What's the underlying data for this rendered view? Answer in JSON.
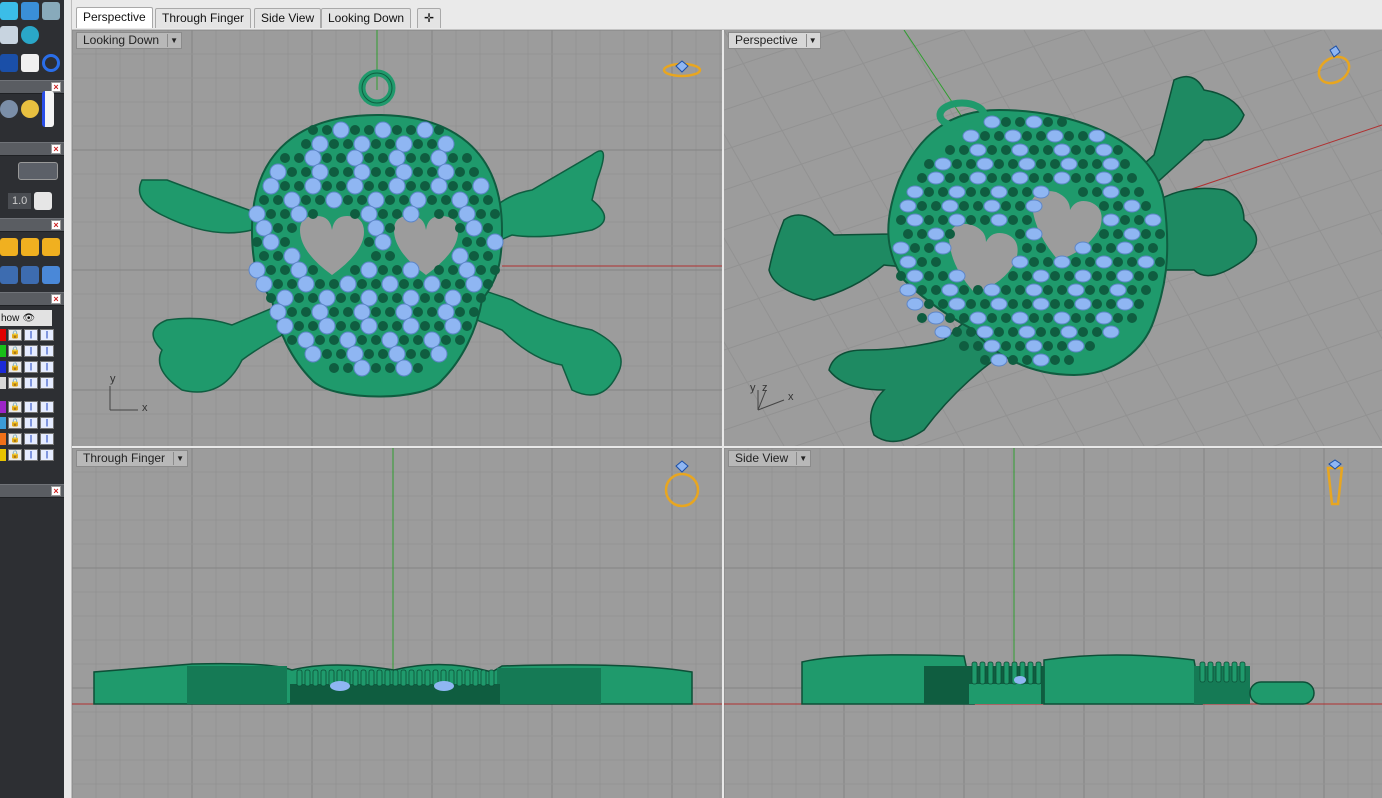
{
  "tabs": [
    {
      "label": "Perspective",
      "active": true
    },
    {
      "label": "Through Finger",
      "active": false
    },
    {
      "label": "Side View",
      "active": false
    },
    {
      "label": "Looking Down",
      "active": false
    }
  ],
  "tab_add_icon": "add-viewport-icon",
  "sidebar": {
    "show_label": "how",
    "size_value": "1.0",
    "layer_colors": [
      "#e00000",
      "#18c018",
      "#1c2ad8",
      "#d8d8d8",
      "#9d24c8",
      "#3c9cd8",
      "#f07018",
      "#e8c400"
    ]
  },
  "viewports": {
    "top_left": {
      "label": "Looking Down",
      "axis_x": "x",
      "axis_y": "y",
      "view_icon": "ring-top-view-icon"
    },
    "top_right": {
      "label": "Perspective",
      "axis_x": "x",
      "axis_y": "y",
      "axis_z": "z",
      "view_icon": "ring-perspective-view-icon"
    },
    "bottom_left": {
      "label": "Through Finger",
      "view_icon": "ring-front-view-icon"
    },
    "bottom_right": {
      "label": "Side View",
      "view_icon": "ring-side-view-icon"
    }
  },
  "colors": {
    "model_green": "#1f9a6c",
    "gem_blue": "#8fb6f2",
    "viewport_bg": "#9c9c9c",
    "grid_line": "#8a8a8a",
    "axis_green": "#2f9e2f",
    "axis_red": "#b03030",
    "view_icon": "#e8a620"
  }
}
